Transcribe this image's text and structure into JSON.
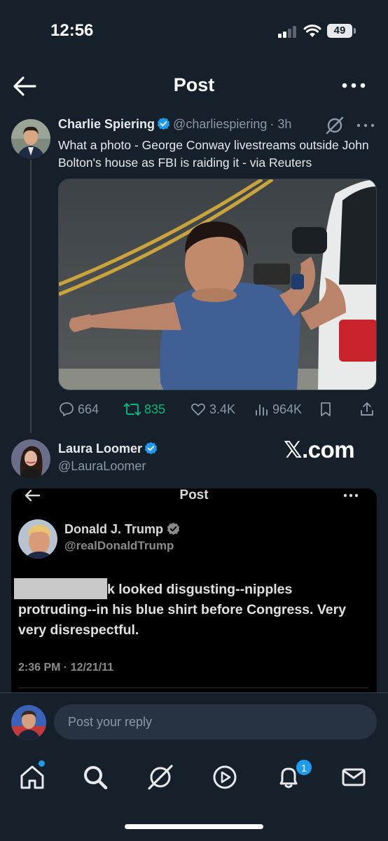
{
  "status_bar": {
    "time": "12:56",
    "battery": "49"
  },
  "header": {
    "title": "Post"
  },
  "tweet": {
    "name": "Charlie Spiering",
    "handle": "@charliespiering",
    "time": "· 3h",
    "text": "What a photo - George Conway livestreams outside John Bolton's house as FBI is raiding it - via Reuters",
    "stats": {
      "replies": "664",
      "reposts": "835",
      "likes": "3.4K",
      "views": "964K"
    }
  },
  "quote": {
    "name": "Laura Loomer",
    "handle": "@LauraLoomer",
    "watermark": "𝕏.com",
    "screenshot": {
      "title": "Post",
      "name": "Donald J. Trump",
      "handle": "@realDonaldTrump",
      "text_line1": "k looked disgusting--nipples",
      "text_rest": "protruding--in his blue shirt before Congress. Very very disrespectful.",
      "date": "2:36 PM · 12/21/11"
    }
  },
  "reply": {
    "placeholder": "Post your reply"
  },
  "nav": {
    "notification_count": "1"
  },
  "colors": {
    "background": "#15202b",
    "accent": "#1d9bf0",
    "repost": "#00ba7c"
  }
}
